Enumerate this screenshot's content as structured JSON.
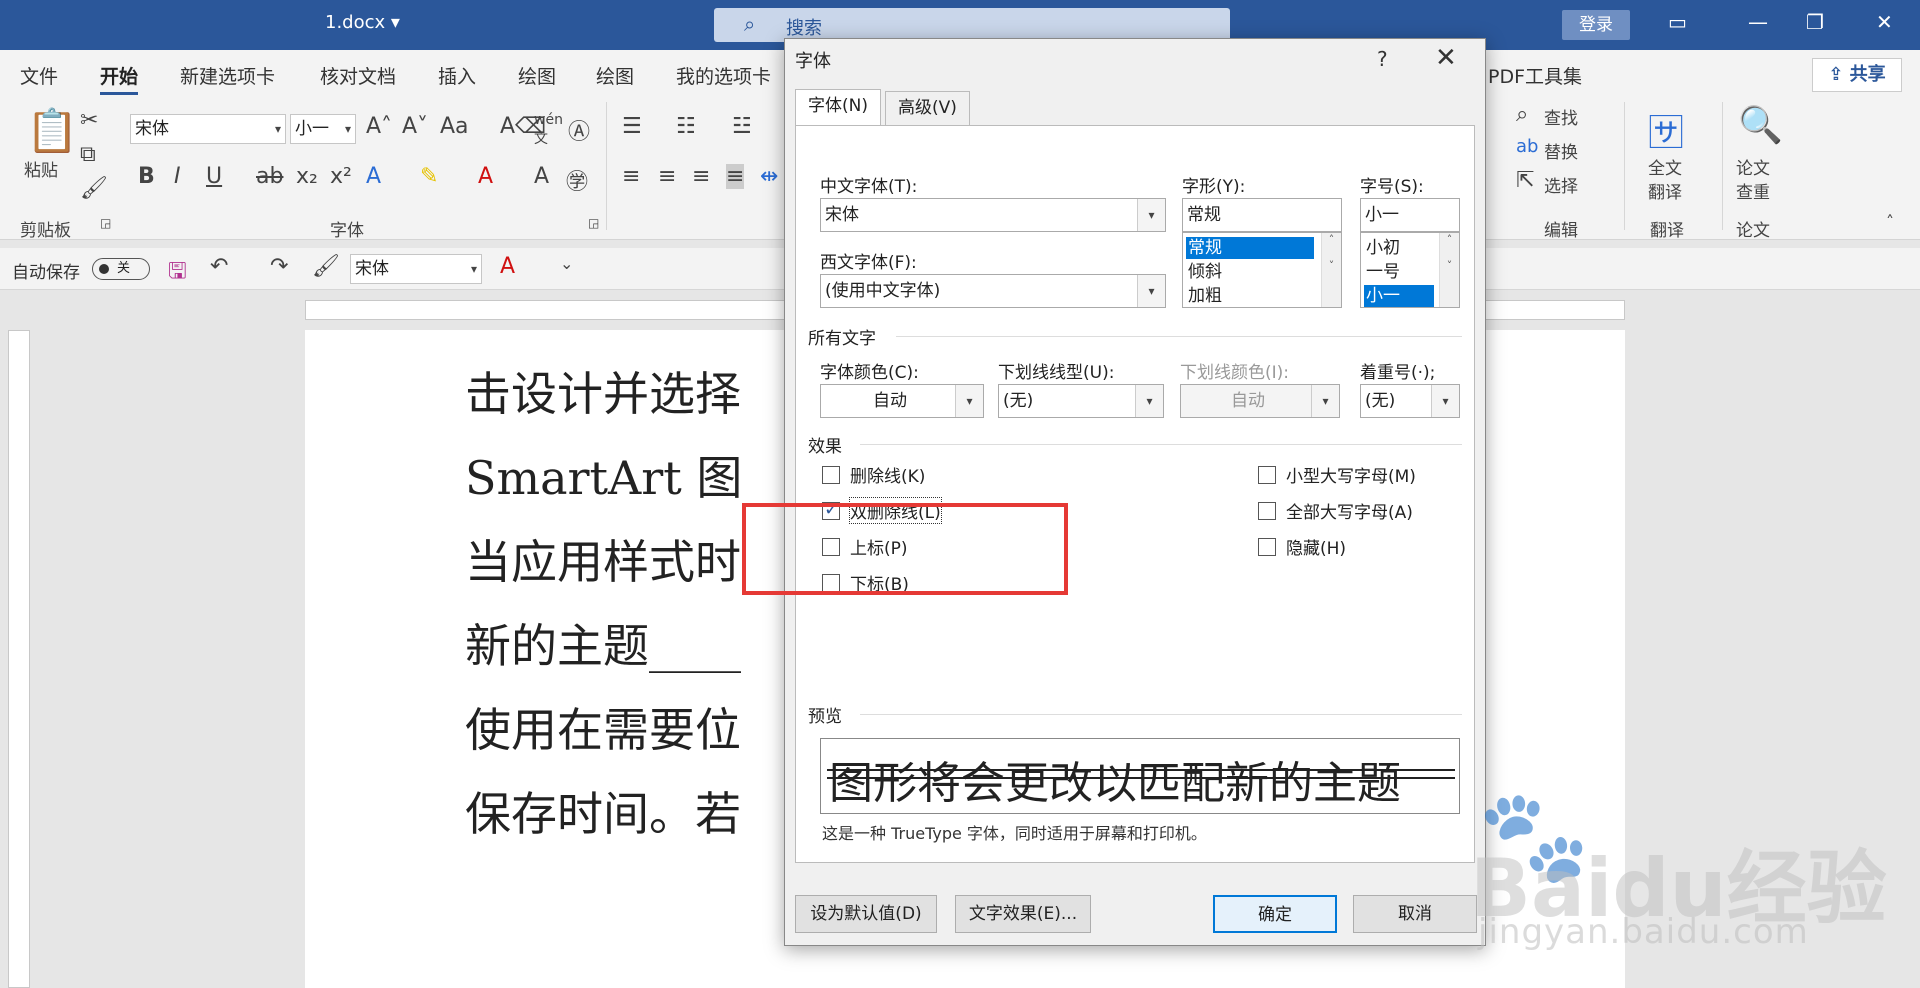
{
  "title_bar": {
    "doc_name": "1.docx ▾",
    "search_placeholder": "搜索",
    "login_label": "登录"
  },
  "ribbon": {
    "tabs": [
      "文件",
      "开始",
      "新建选项卡",
      "核对文档",
      "插入",
      "绘图",
      "绘图",
      "我的选项卡"
    ],
    "active_tab": "开始",
    "pdf_tab": "PDF工具集",
    "share_label": "共享",
    "clipboard": {
      "paste_label": "粘贴",
      "group_label": "剪贴板"
    },
    "font": {
      "font_name": "宋体",
      "font_size": "小一",
      "group_label": "字体"
    },
    "edit": {
      "find": "查找",
      "replace": "替换",
      "select": "选择",
      "group_label": "编辑"
    },
    "translate": {
      "btn": "全文\n翻译",
      "btn_line1": "全文",
      "btn_line2": "翻译",
      "group_label": "翻译"
    },
    "paper": {
      "btn_line1": "论文",
      "btn_line2": "查重",
      "group_label": "论文"
    }
  },
  "qat": {
    "autosave_label": "自动保存",
    "autosave_state": "关",
    "font_name": "宋体"
  },
  "document": {
    "lines": [
      "击设计并选择",
      "SmartArt  图",
      "当应用样式时",
      "新的主题____",
      "使用在需要位",
      "保存时间。若"
    ]
  },
  "dialog": {
    "title": "字体",
    "help": "?",
    "tabs": [
      "字体(N)",
      "高级(V)"
    ],
    "cn_font_label": "中文字体(T):",
    "cn_font_value": "宋体",
    "west_font_label": "西文字体(F):",
    "west_font_value": "(使用中文字体)",
    "style_label": "字形(Y):",
    "style_value": "常规",
    "style_options": [
      "常规",
      "倾斜",
      "加粗"
    ],
    "size_label": "字号(S):",
    "size_value": "小一",
    "size_options": [
      "小初",
      "一号",
      "小一"
    ],
    "all_text_title": "所有文字",
    "color_label": "字体颜色(C):",
    "color_value": "自动",
    "underline_label": "下划线线型(U):",
    "underline_value": "(无)",
    "underline_color_label": "下划线颜色(I):",
    "underline_color_value": "自动",
    "emphasis_label": "着重号(·);",
    "emphasis_value": "(无)",
    "effects_title": "效果",
    "effects": {
      "strike": "删除线(K)",
      "double_strike": "双删除线(L)",
      "superscript": "上标(P)",
      "subscript": "下标(B)",
      "small_caps": "小型大写字母(M)",
      "all_caps": "全部大写字母(A)",
      "hidden": "隐藏(H)"
    },
    "preview_title": "预览",
    "preview_text": "图形将会更改以匹配新的主题",
    "preview_caption": "这是一种 TrueType 字体，同时适用于屏幕和打印机。",
    "buttons": {
      "set_default": "设为默认值(D)",
      "text_effects": "文字效果(E)...",
      "ok": "确定",
      "cancel": "取消"
    }
  },
  "watermark": {
    "text": "Baidu经验",
    "sub": "jingyan.baidu.com"
  }
}
